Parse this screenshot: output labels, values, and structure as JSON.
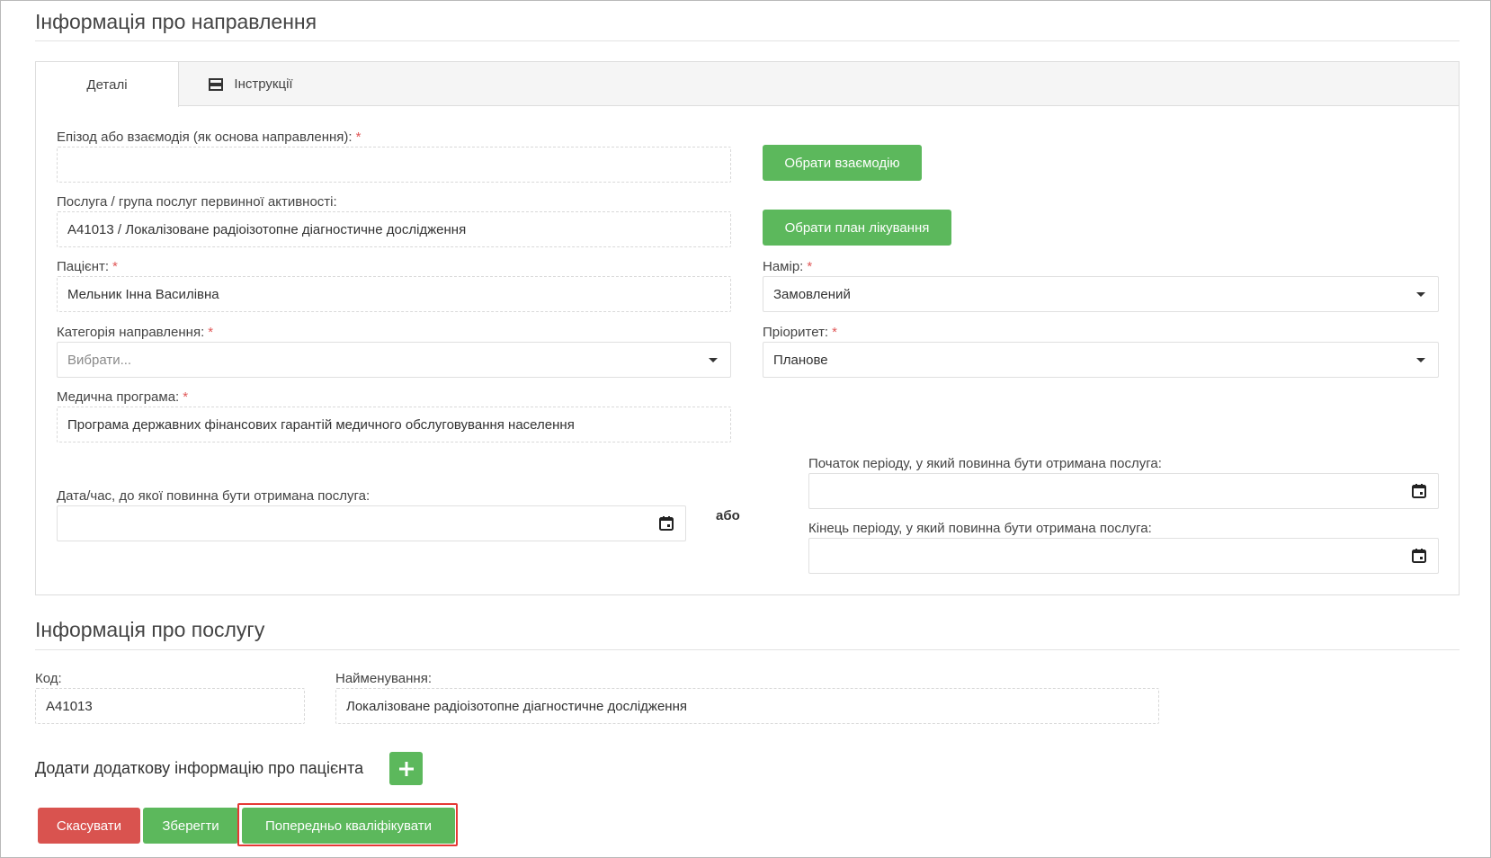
{
  "referral_section": {
    "title": "Інформація про направлення",
    "tabs": [
      {
        "label": "Деталі",
        "active": true
      },
      {
        "label": "Інструкції",
        "icon": "list-icon",
        "active": false
      }
    ],
    "episode": {
      "label": "Епізод або взаємодія (як основа направлення):",
      "required": "*",
      "value": ""
    },
    "select_interaction_button": "Обрати взаємодію",
    "service": {
      "label": "Послуга / група послуг первинної активності:",
      "value": "A41013 / Локалізоване радіоізотопне діагностичне дослідження"
    },
    "select_plan_button": "Обрати план лікування",
    "patient": {
      "label": "Пацієнт:",
      "required": "*",
      "value": "Мельник Інна Василівна"
    },
    "intent": {
      "label": "Намір:",
      "required": "*",
      "value": "Замовлений"
    },
    "category": {
      "label": "Категорія направлення:",
      "required": "*",
      "placeholder": "Вибрати..."
    },
    "priority": {
      "label": "Пріоритет:",
      "required": "*",
      "value": "Планове"
    },
    "program": {
      "label": "Медична програма:",
      "required": "*",
      "value": "Програма державних фінансових гарантій медичного обслуговування населення"
    },
    "deadline": {
      "label": "Дата/час, до якої повинна бути отримана послуга:",
      "value": ""
    },
    "or_text": "або",
    "period_start": {
      "label": "Початок періоду, у який повинна бути отримана послуга:",
      "value": ""
    },
    "period_end": {
      "label": "Кінець періоду, у який повинна бути отримана послуга:",
      "value": ""
    }
  },
  "service_section": {
    "title": "Інформація про послугу",
    "code": {
      "label": "Код:",
      "value": "A41013"
    },
    "name": {
      "label": "Найменування:",
      "value": "Локалізоване радіоізотопне діагностичне дослідження"
    }
  },
  "additional_info": {
    "label": "Додати додаткову інформацію про пацієнта",
    "icon": "plus-icon"
  },
  "actions": {
    "cancel": "Скасувати",
    "save": "Зберегти",
    "prequalify": "Попередньо кваліфікувати"
  },
  "colors": {
    "green": "#5cb85c",
    "red": "#d9534f",
    "highlight": "#e53935",
    "required": "#e05757"
  }
}
